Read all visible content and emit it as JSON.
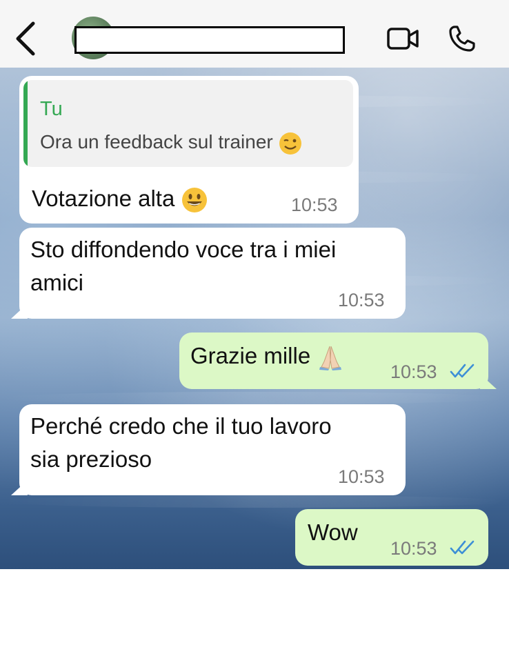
{
  "header": {
    "contact_name": "",
    "icons": [
      "chevron-left-icon",
      "video-call-icon",
      "phone-icon"
    ]
  },
  "messages": [
    {
      "direction": "incoming",
      "reply_to": {
        "sender": "Tu",
        "text": "Ora un feedback sul trainer"
      },
      "text": "Votazione alta",
      "time": "10:53"
    },
    {
      "direction": "incoming",
      "lines": [
        "Sto diffondendo voce tra i miei",
        "amici"
      ],
      "time": "10:53"
    },
    {
      "direction": "outgoing",
      "text": "Grazie mille",
      "time": "10:53",
      "status": "read"
    },
    {
      "direction": "incoming",
      "lines": [
        "Perché credo che il tuo lavoro",
        "sia prezioso"
      ],
      "time": "10:53"
    },
    {
      "direction": "outgoing",
      "text": "Wow",
      "time": "10:53",
      "status": "read"
    }
  ],
  "colors": {
    "outgoing_bubble": "#dcf8c6",
    "incoming_bubble": "#ffffff",
    "quote_accent": "#34a853",
    "read_ticks": "#3d8fd6"
  }
}
